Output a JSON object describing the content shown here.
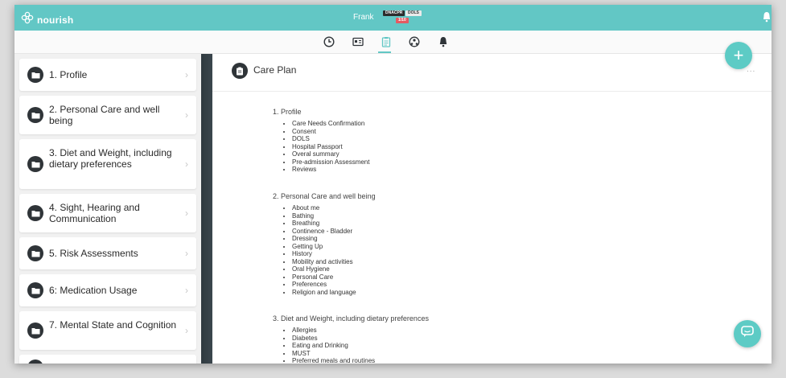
{
  "topbar": {
    "logo_text": "nourish",
    "resident_name": "Frank",
    "badges": {
      "dnacpr": "DNACPR",
      "dols": "DOLS",
      "count": "1/10"
    }
  },
  "toolbar": {
    "icons": [
      "clock-icon",
      "id-card-icon",
      "clipboard-icon",
      "people-network-icon",
      "bell-icon"
    ],
    "active": "clipboard-icon"
  },
  "sidebar": {
    "items": [
      {
        "label": "1. Profile"
      },
      {
        "label": "2. Personal Care and well being"
      },
      {
        "label": "3. Diet and Weight, including dietary preferences"
      },
      {
        "label": "4. Sight, Hearing and Communication"
      },
      {
        "label": "5. Risk Assessments"
      },
      {
        "label": "6: Medication Usage"
      },
      {
        "label": "7. Mental State and Cognition"
      }
    ]
  },
  "main": {
    "title": "Care Plan",
    "more": "...",
    "sections": [
      {
        "title": "1. Profile",
        "items": [
          "Care Needs Confirmation",
          "Consent",
          "DOLS",
          "Hospital Passport",
          "Overal summary",
          "Pre-admission Assessment",
          "Reviews"
        ]
      },
      {
        "title": "2. Personal Care and well being",
        "items": [
          "About me",
          "Bathing",
          "Breathing",
          "Continence - Bladder",
          "Dressing",
          "Getting Up",
          "History",
          "Mobility and activities",
          "Oral Hygiene",
          "Personal Care",
          "Preferences",
          "Religion and language"
        ]
      },
      {
        "title": "3. Diet and Weight, including dietary preferences",
        "items": [
          "Allergies",
          "Diabetes",
          "Eating and Drinking",
          "MUST",
          "Preferred meals and routines"
        ]
      }
    ]
  },
  "colors": {
    "accent": "#62c7c5",
    "dark": "#2f3438",
    "alert": "#e45b62"
  }
}
